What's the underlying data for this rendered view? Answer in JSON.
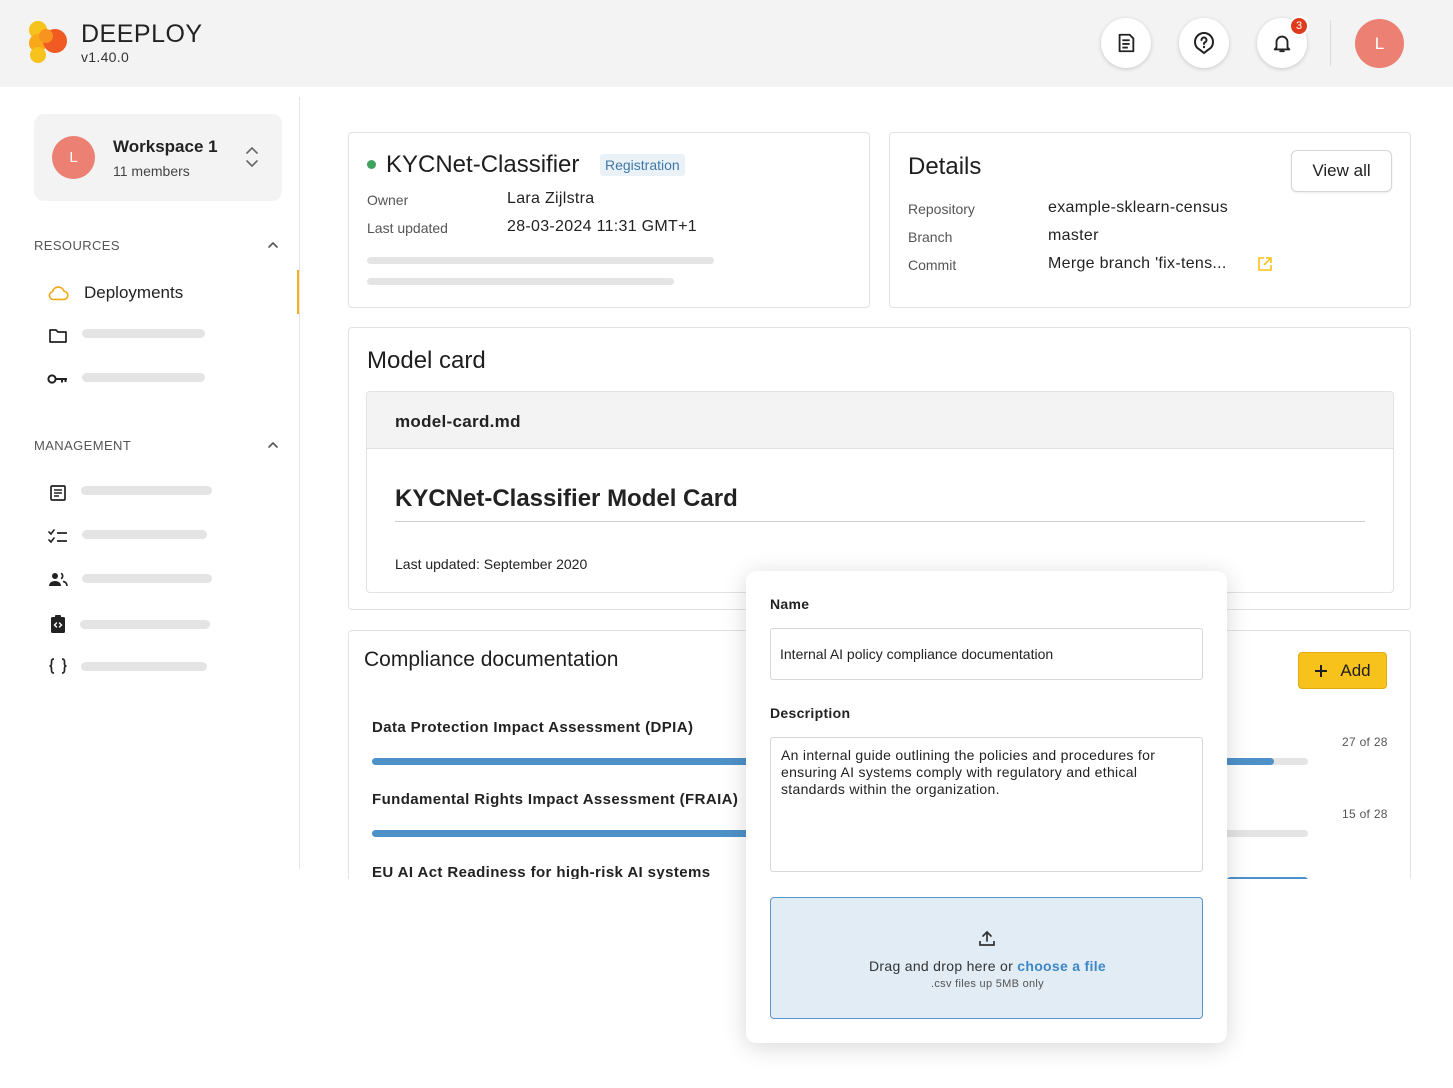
{
  "app": {
    "name": "DEEPLOY",
    "version": "v1.40.0",
    "notification_count": "3",
    "user_initial": "L"
  },
  "workspace": {
    "initial": "L",
    "name": "Workspace 1",
    "members": "11 members"
  },
  "sidebar": {
    "resources_label": "RESOURCES",
    "management_label": "MANAGEMENT",
    "active_item": "Deployments"
  },
  "model": {
    "name": "KYCNet-Classifier",
    "badge": "Registration",
    "owner_label": "Owner",
    "owner": "Lara Zijlstra",
    "updated_label": "Last updated",
    "updated": "28-03-2024 11:31 GMT+1"
  },
  "details": {
    "title": "Details",
    "view_all": "View all",
    "repository_label": "Repository",
    "repository": "example-sklearn-census",
    "branch_label": "Branch",
    "branch": "master",
    "commit_label": "Commit",
    "commit": "Merge branch 'fix-tens..."
  },
  "model_card": {
    "title": "Model card",
    "filename": "model-card.md",
    "heading": "KYCNet-Classifier Model Card",
    "text": "Last updated: September 2020"
  },
  "compliance": {
    "title": "Compliance documentation",
    "add_label": "Add",
    "items": [
      {
        "title": "Data Protection Impact Assessment (DPIA)",
        "count": "27 of 28",
        "progress": 0.964
      },
      {
        "title": "Fundamental Rights Impact Assessment (FRAIA)",
        "count": "15 of 28",
        "progress": 0.536
      },
      {
        "title": "EU AI Act Readiness for high-risk AI systems"
      }
    ]
  },
  "form": {
    "name_label": "Name",
    "name_value": "Internal AI policy compliance documentation",
    "description_label": "Description",
    "description_value": "An internal guide outlining the policies and procedures for ensuring AI systems comply with regulatory and ethical standards within the organization.",
    "upload_text": "Drag and drop here or",
    "upload_link": "choose a file",
    "upload_hint": ".csv files up 5MB only"
  },
  "colors": {
    "accent": "#f7c21b",
    "avatar": "#ec8073",
    "status_ok": "#3ca45c",
    "progress": "#4e91c9",
    "notification": "#e03a1e"
  }
}
